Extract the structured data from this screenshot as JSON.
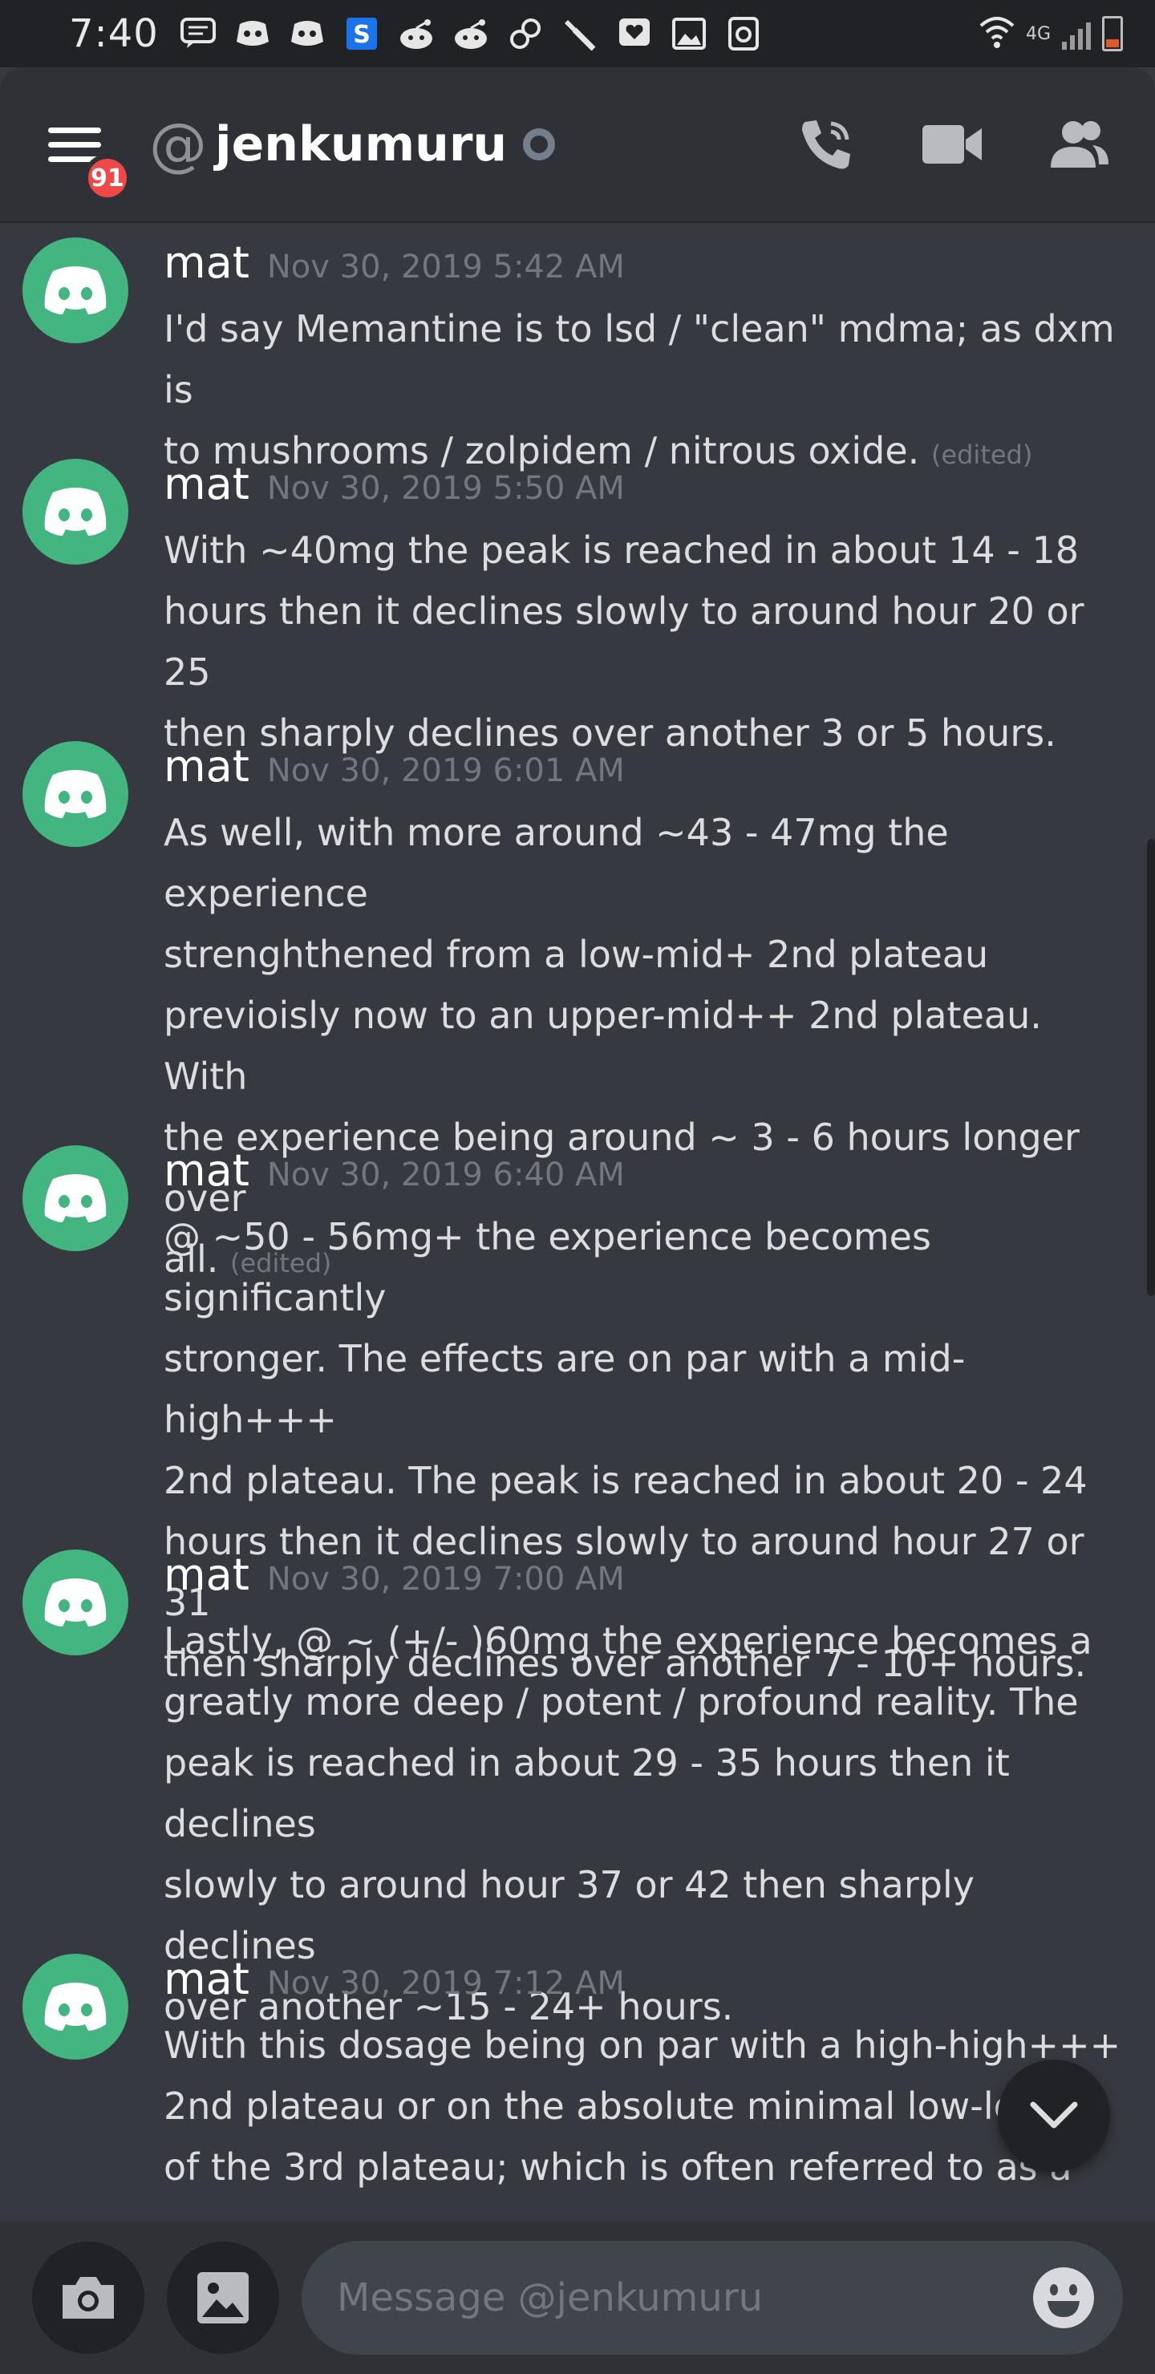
{
  "status_bar": {
    "time": "7:40",
    "network": "4G",
    "notification_icons": [
      "message-icon",
      "discord-icon",
      "discord-icon",
      "app-s-icon",
      "reddit-icon",
      "reddit-icon",
      "link-icon",
      "wrench-icon",
      "heart-icon",
      "image-icon",
      "app-icon"
    ]
  },
  "header": {
    "unread_badge": "91",
    "at_symbol": "@",
    "channel_name": "jenkumuru",
    "icons": [
      "call-icon",
      "video-icon",
      "members-icon"
    ]
  },
  "messages": [
    {
      "author": "mat",
      "timestamp": "Nov 30, 2019 5:42 AM",
      "lines": [
        "I'd say Memantine is to lsd / \"clean\" mdma; as dxm is",
        "to mushrooms / zolpidem / nitrous oxide."
      ],
      "edited": "(edited)"
    },
    {
      "author": "mat",
      "timestamp": "Nov 30, 2019 5:50 AM",
      "lines": [
        "With ~40mg the peak is reached in about 14 - 18",
        "hours then it declines slowly to around hour 20 or 25",
        "then sharply declines over another 3 or 5 hours."
      ],
      "edited": ""
    },
    {
      "author": "mat",
      "timestamp": "Nov 30, 2019 6:01 AM",
      "lines": [
        "As well, with more around ~43 - 47mg the experience",
        "strenghthened from a low-mid+ 2nd plateau",
        "previoisly now to an upper-mid++ 2nd plateau. With",
        "the experience being around ~ 3 - 6 hours longer over",
        "all."
      ],
      "edited": "(edited)"
    },
    {
      "author": "mat",
      "timestamp": "Nov 30, 2019 6:40 AM",
      "lines": [
        "@ ~50 - 56mg+ the experience becomes significantly",
        "stronger. The effects are on par with a mid-high+++",
        "2nd plateau. The peak is reached in about 20 - 24",
        "hours then it declines slowly to around hour 27 or 31",
        "then sharply declines over another 7 - 10+ hours."
      ],
      "edited": ""
    },
    {
      "author": "mat",
      "timestamp": "Nov 30, 2019 7:00 AM",
      "lines": [
        "Lastly, @ ~ (+/- )60mg the experience becomes a",
        "greatly more deep / potent / profound reality. The",
        "peak is reached in about 29 - 35 hours then it declines",
        "slowly to around hour 37 or 42 then sharply declines",
        "over another ~15 - 24+ hours."
      ],
      "edited": ""
    },
    {
      "author": "mat",
      "timestamp": "Nov 30, 2019 7:12 AM",
      "lines": [
        "With this dosage being on par with a high-high+++",
        "2nd plateau or on the absolute minimal low-low",
        "of the 3rd plateau; which is often referred to as a"
      ],
      "edited": ""
    }
  ],
  "composer": {
    "placeholder": "Message @jenkumuru",
    "icons": [
      "camera-icon",
      "image-icon",
      "emoji-icon"
    ]
  },
  "colors": {
    "background": "#36393f",
    "header": "#2f3136",
    "avatar": "#43b581",
    "badge": "#f04747",
    "timestamp": "#72767d"
  }
}
